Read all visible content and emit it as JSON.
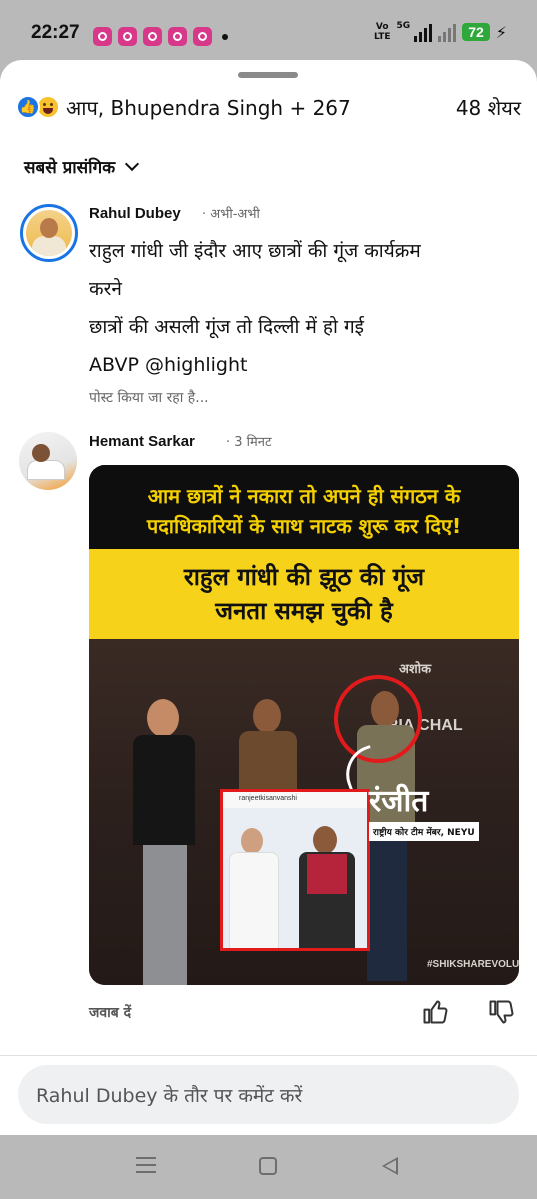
{
  "status_bar": {
    "time": "22:27",
    "notification_icons": [
      "instagram-icon",
      "instagram-icon",
      "instagram-icon",
      "instagram-icon",
      "instagram-icon"
    ],
    "volte": "Vo\nLTE",
    "network": "5G",
    "battery": "72",
    "battery_color": "#2ea83a"
  },
  "sheet": {
    "reactions": {
      "icons": [
        "like-icon",
        "haha-icon"
      ],
      "text": "आप, Bhupendra Singh + 267",
      "shares": "48 शेयर"
    },
    "sort_label": "सबसे प्रासंगिक"
  },
  "comments": [
    {
      "name": "Rahul Dubey",
      "time": "· अभी-अभी",
      "lines": [
        "राहुल गांधी जी इंदौर आए छात्रों की गूंज कार्यक्रम",
        "करने",
        "छात्रों की असली गूंज तो दिल्ली में हो गई",
        "ABVP @highlight"
      ],
      "status": "पोस्ट किया जा रहा है..."
    },
    {
      "name": "Hemant Sarkar",
      "time": "· 3 मिनट",
      "image": {
        "headline_lines": [
          "आम छात्रों ने नकारा तो अपने ही संगठन के",
          "पदाधिकारियों के साथ नाटक शुरू कर दिए!"
        ],
        "banner_lines": [
          "राहुल गांधी की झूठ की गूंज",
          "जनता समझ चुकी है"
        ],
        "stage_text_top": "अशोक",
        "stage_text_mid": "TRIA  CHAL",
        "name_label": "रंजीत",
        "name_subtitle": "राष्ट्रीय कोर टीम मेंबर, NEYU",
        "inset_handle": "ranjeetkisanvanshi",
        "hashtag": "#SHIKSHAREVOLU"
      },
      "reply_label": "जवाब दें"
    }
  ],
  "composer": {
    "placeholder": "Rahul Dubey के तौर पर कमेंट करें"
  },
  "accent_color": "#1b74e4"
}
